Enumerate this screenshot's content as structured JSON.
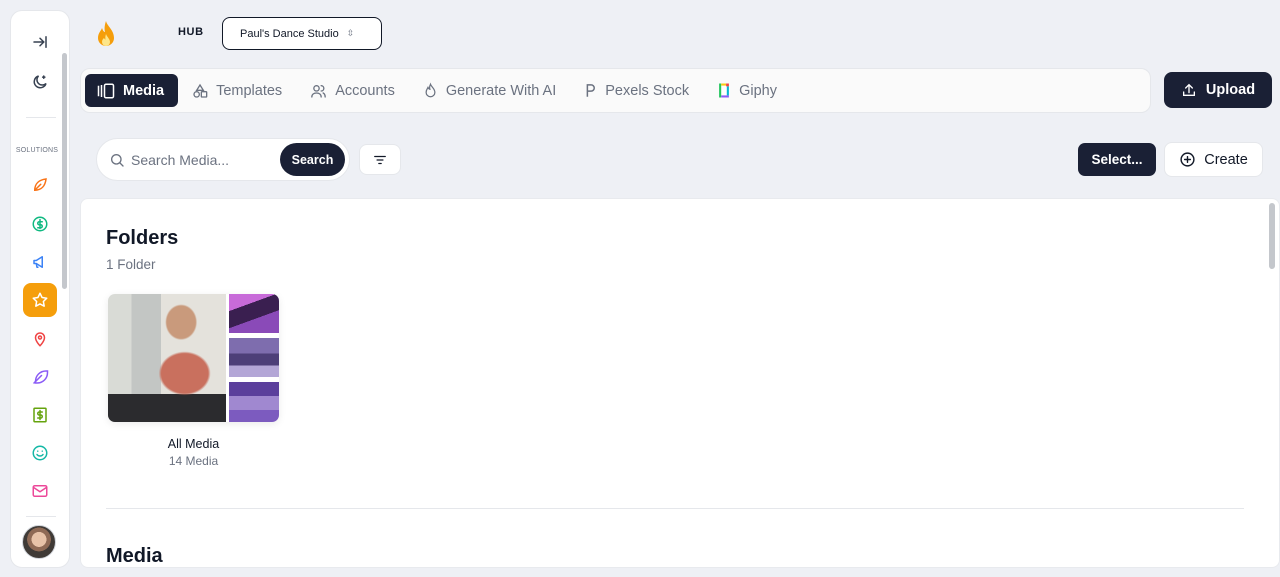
{
  "rail": {
    "section_label": "SOLUTIONS",
    "icons": [
      "leaf-icon",
      "dollar-circle-icon",
      "megaphone-icon",
      "star-icon",
      "map-pin-icon",
      "feather-icon",
      "dollar-square-icon",
      "smile-icon",
      "mail-icon"
    ],
    "active_icon": "star-icon",
    "accent_colors": {
      "leaf": "#f97316",
      "dollar_circle": "#10b981",
      "megaphone": "#3b82f6",
      "star_bg": "#f59e0b",
      "map_pin": "#ef4444",
      "feather": "#8b5cf6",
      "dollar_square": "#65a30d",
      "smile": "#14b8a6",
      "mail": "#ec4899"
    }
  },
  "header": {
    "hub_label": "HUB",
    "studio_name": "Paul's Dance Studio"
  },
  "tabs": [
    {
      "label": "Media",
      "icon": "media-library-icon",
      "active": true
    },
    {
      "label": "Templates",
      "icon": "shapes-icon",
      "active": false
    },
    {
      "label": "Accounts",
      "icon": "users-icon",
      "active": false
    },
    {
      "label": "Generate With AI",
      "icon": "flame-icon",
      "active": false
    },
    {
      "label": "Pexels Stock",
      "icon": "pexels-icon",
      "active": false
    },
    {
      "label": "Giphy",
      "icon": "giphy-icon",
      "active": false
    }
  ],
  "toolbar": {
    "upload_label": "Upload",
    "search_placeholder": "Search Media...",
    "search_button": "Search",
    "select_label": "Select...",
    "create_label": "Create"
  },
  "folders": {
    "title": "Folders",
    "count": "1 Folder",
    "items": [
      {
        "name": "All Media",
        "sub": "14 Media"
      }
    ]
  },
  "media": {
    "title": "Media"
  },
  "colors": {
    "primary_dark": "#1a2035",
    "background": "#eef0f5"
  }
}
